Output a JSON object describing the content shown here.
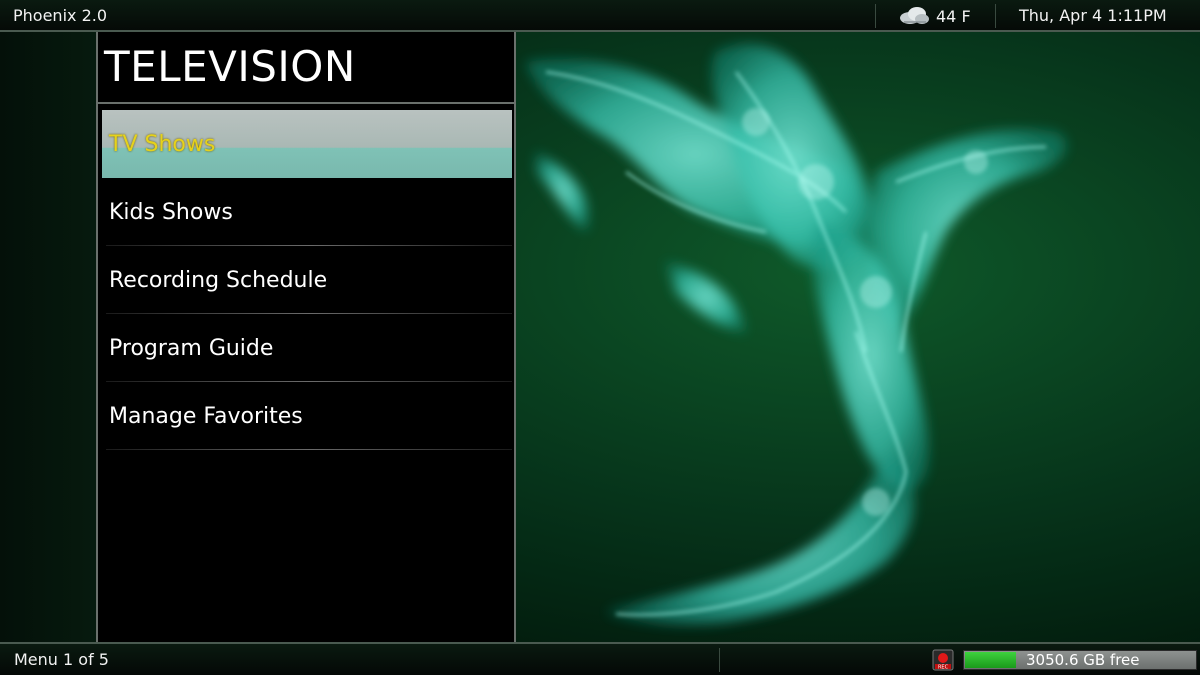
{
  "app": {
    "title": "Phoenix 2.0"
  },
  "status": {
    "weather_icon": "cloud-icon",
    "temperature": "44 F",
    "datetime": "Thu, Apr 4  1:11PM"
  },
  "panel": {
    "title": "TELEVISION",
    "items": [
      {
        "label": "TV Shows",
        "selected": true
      },
      {
        "label": "Kids Shows",
        "selected": false
      },
      {
        "label": "Recording Schedule",
        "selected": false
      },
      {
        "label": "Program Guide",
        "selected": false
      },
      {
        "label": "Manage Favorites",
        "selected": false
      }
    ]
  },
  "footer": {
    "menu_position": "Menu 1 of 5",
    "rec_icon": "rec-icon",
    "disk_free": "3050.6 GB free",
    "disk_used_fraction": 0.22
  },
  "colors": {
    "selected_text": "#e6d21a",
    "selected_bg": "#9fc5bd",
    "art_smoke": "#4fe0cf",
    "background_green": "#0f5a2a",
    "disk_fill": "#2cbc2c"
  }
}
